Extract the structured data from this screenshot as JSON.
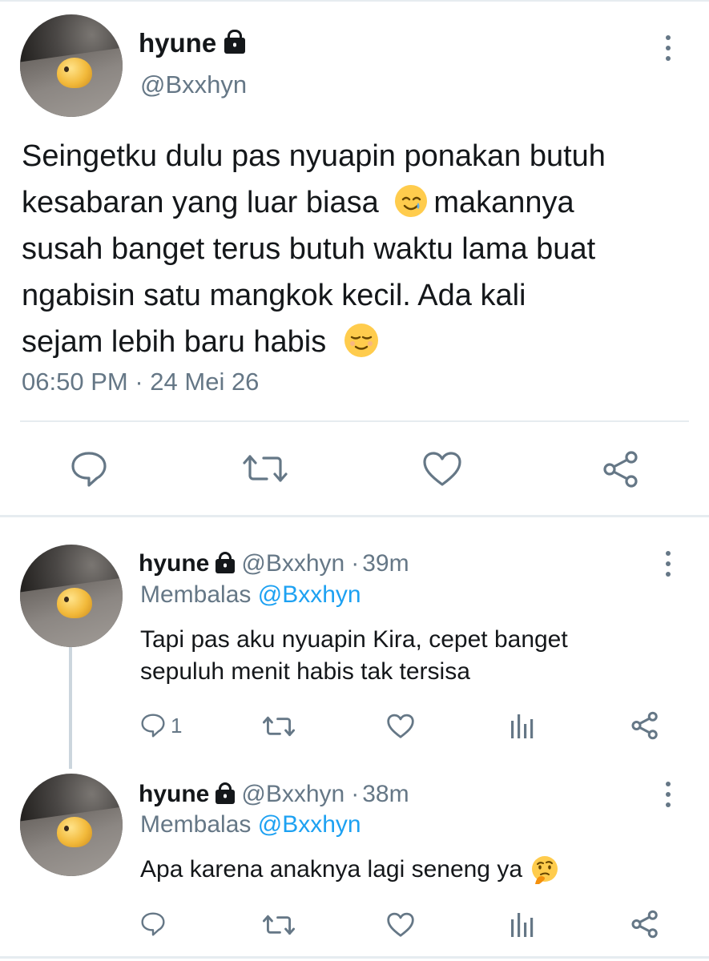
{
  "main_tweet": {
    "author_name": "hyune",
    "author_handle": "@Bxxhyn",
    "text_lines": [
      "Seingetku dulu pas nyuapin ponakan butuh",
      "kesabaran yang luar biasa",
      "makannya",
      "susah banget terus butuh waktu lama buat",
      "ngabisin satu mangkok kecil. Ada kali",
      "sejam lebih baru habis"
    ],
    "time": "06:50 PM",
    "separator": "·",
    "date": "24 Mei 26",
    "icons": [
      "avatar",
      "lock-icon",
      "more-vert-icon",
      "smiling-tear-emoji",
      "relieved-face-emoji",
      "reply-icon",
      "retweet-icon",
      "like-icon",
      "share-icon"
    ]
  },
  "replies": [
    {
      "author_name": "hyune",
      "author_handle": "@Bxxhyn",
      "time_ago": "39m",
      "separator": "·",
      "replying_prefix": "Membalas",
      "replying_to": "@Bxxhyn",
      "text_lines": [
        "Tapi pas aku nyuapin Kira, cepet banget",
        "sepuluh menit habis tak tersisa"
      ],
      "reply_count": "1",
      "icons": [
        "reply-icon",
        "retweet-icon",
        "like-icon",
        "analytics-icon",
        "share-icon"
      ]
    },
    {
      "author_name": "hyune",
      "author_handle": "@Bxxhyn",
      "time_ago": "38m",
      "separator": "·",
      "replying_prefix": "Membalas",
      "replying_to": "@Bxxhyn",
      "text_lines": [
        "Apa karena anaknya lagi seneng ya"
      ],
      "reply_count": "",
      "icons": [
        "thinking-face-emoji",
        "reply-icon",
        "retweet-icon",
        "like-icon",
        "analytics-icon",
        "share-icon"
      ]
    }
  ],
  "colors": {
    "text": "#14171a",
    "secondary": "#657786",
    "link": "#1da1f2",
    "divider": "#e6ecf0",
    "section_gap": "#e6ecf0"
  }
}
